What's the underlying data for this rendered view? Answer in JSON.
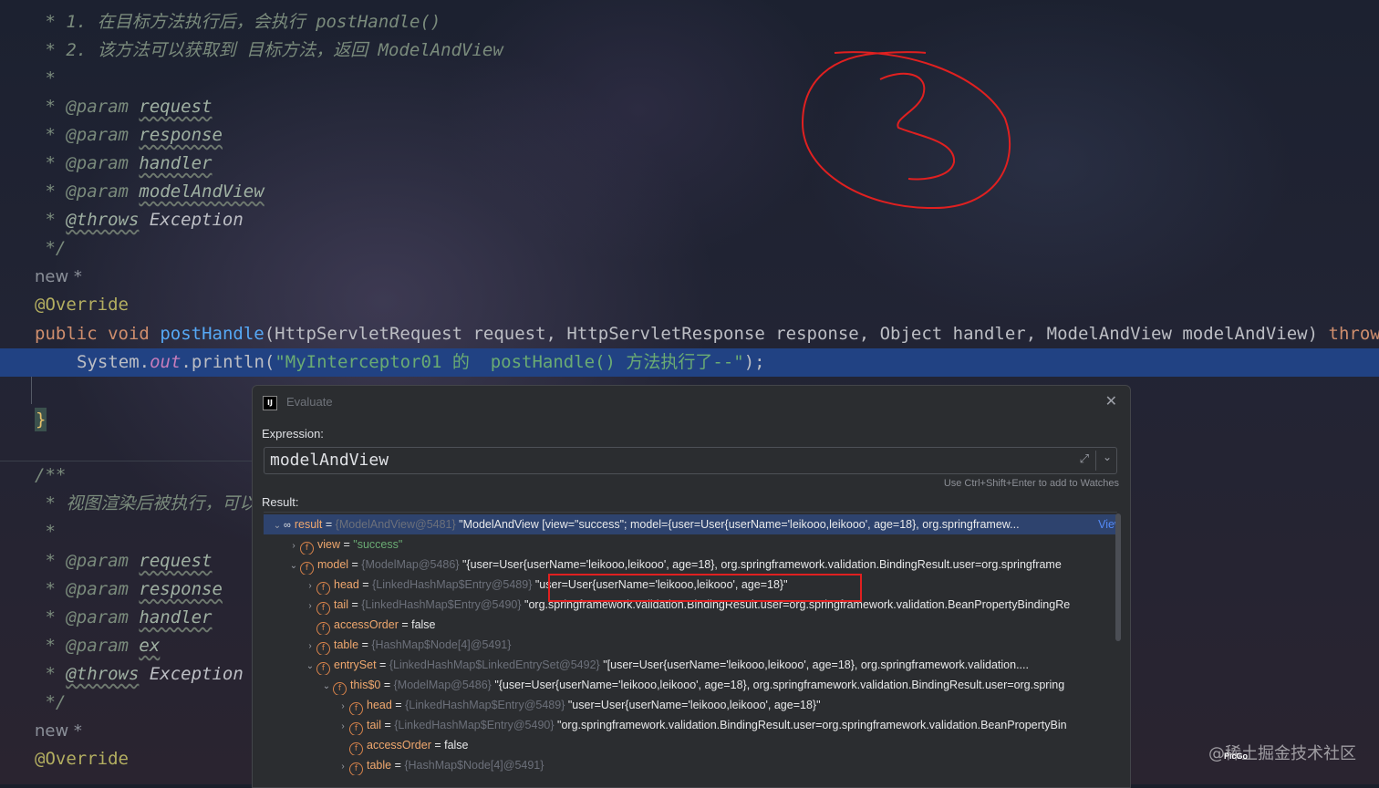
{
  "editor": {
    "lines_top": [
      {
        "prefix": " * 1. ",
        "comment": "在目标方法执行后，会执行 postHandle()"
      },
      {
        "prefix": " * 2. ",
        "comment": "该方法可以获取到 目标方法，返回 ModelAndView"
      },
      {
        "prefix": " *",
        "comment": ""
      }
    ],
    "params_top": [
      {
        "tag": "@param",
        "name": "request"
      },
      {
        "tag": "@param",
        "name": "response"
      },
      {
        "tag": "@param",
        "name": "handler"
      },
      {
        "tag": "@param",
        "name": "modelAndView"
      }
    ],
    "throws_tag": "@throws",
    "throws_type": "Exception",
    "comment_end": " */",
    "new_hint": "new *",
    "override": "@Override",
    "sig": {
      "kw1": "public",
      "kw2": "void",
      "method": "postHandle",
      "params": "(HttpServletRequest request, HttpServletResponse response, Object handler, ModelAndView modelAndView)",
      "throws": "throws"
    },
    "exec": {
      "obj": "System.",
      "field": "out",
      "call": ".println(",
      "str": "\"MyInterceptor01 的  postHandle() 方法执行了--\"",
      "end": ");"
    },
    "brace": "}",
    "doc_start": "/**",
    "doc_line": " * 视图渲染后被执行，可以",
    "star": " *",
    "params_bottom": [
      {
        "tag": "@param",
        "name": "request"
      },
      {
        "tag": "@param",
        "name": "response"
      },
      {
        "tag": "@param",
        "name": "handler"
      },
      {
        "tag": "@param",
        "name": "ex"
      }
    ]
  },
  "dialog": {
    "title": "Evaluate",
    "expression_label": "Expression:",
    "expression_value": "modelAndView",
    "watch_hint": "Use Ctrl+Shift+Enter to add to Watches",
    "result_label": "Result:",
    "view_link": "View",
    "rows": [
      {
        "arrow": "⌄",
        "icon": "oo",
        "name": "result",
        "ref": "{ModelAndView@5481}",
        "value": "\"ModelAndView [view=\"success\"; model={user=User{userName='leikooo,leikooo', age=18}, org.springframew...",
        "kind": "val"
      },
      {
        "arrow": "›",
        "icon": "f",
        "name": "view",
        "ref": "",
        "value": "\"success\"",
        "kind": "str"
      },
      {
        "arrow": "⌄",
        "icon": "f",
        "name": "model",
        "ref": "{ModelMap@5486}",
        "value": "\"{user=User{userName='leikooo,leikooo', age=18}, org.springframework.validation.BindingResult.user=org.springframe",
        "kind": "val"
      },
      {
        "arrow": "›",
        "icon": "f",
        "name": "head",
        "ref": "{LinkedHashMap$Entry@5489}",
        "value": "\"user=User{userName='leikooo,leikooo', age=18}\"",
        "kind": "val"
      },
      {
        "arrow": "›",
        "icon": "f",
        "name": "tail",
        "ref": "{LinkedHashMap$Entry@5490}",
        "value": "\"org.springframework.validation.BindingResult.user=org.springframework.validation.BeanPropertyBindingRe",
        "kind": "val"
      },
      {
        "arrow": "",
        "icon": "f",
        "name": "accessOrder",
        "ref": "",
        "value": "false",
        "kind": "val"
      },
      {
        "arrow": "›",
        "icon": "f",
        "name": "table",
        "ref": "{HashMap$Node[4]@5491}",
        "value": "",
        "kind": "val"
      },
      {
        "arrow": "⌄",
        "icon": "f",
        "name": "entrySet",
        "ref": "{LinkedHashMap$LinkedEntrySet@5492}",
        "value": "\"[user=User{userName='leikooo,leikooo', age=18}, org.springframework.validation.",
        "kind": "val"
      },
      {
        "arrow": "⌄",
        "icon": "f",
        "name": "this$0",
        "ref": "{ModelMap@5486}",
        "value": "\"{user=User{userName='leikooo,leikooo', age=18}, org.springframework.validation.BindingResult.user=org.spring",
        "kind": "val"
      },
      {
        "arrow": "›",
        "icon": "f",
        "name": "head",
        "ref": "{LinkedHashMap$Entry@5489}",
        "value": "\"user=User{userName='leikooo,leikooo', age=18}\"",
        "kind": "val"
      },
      {
        "arrow": "›",
        "icon": "f",
        "name": "tail",
        "ref": "{LinkedHashMap$Entry@5490}",
        "value": "\"org.springframework.validation.BindingResult.user=org.springframework.validation.BeanPropertyBin",
        "kind": "val"
      },
      {
        "arrow": "",
        "icon": "f",
        "name": "accessOrder",
        "ref": "",
        "value": "false",
        "kind": "val"
      },
      {
        "arrow": "›",
        "icon": "f",
        "name": "table",
        "ref": "{HashMap$Node[4]@5491}",
        "value": "",
        "kind": "val"
      }
    ]
  },
  "overlay": {
    "watermark": "@稀土掘金技术社区",
    "picgo": "PicGo",
    "annotation_color": "#e02020"
  },
  "colors": {
    "exec_highlight": "#214283",
    "keyword": "#cf8e6d",
    "method": "#56a8f5",
    "string": "#6aab73"
  }
}
